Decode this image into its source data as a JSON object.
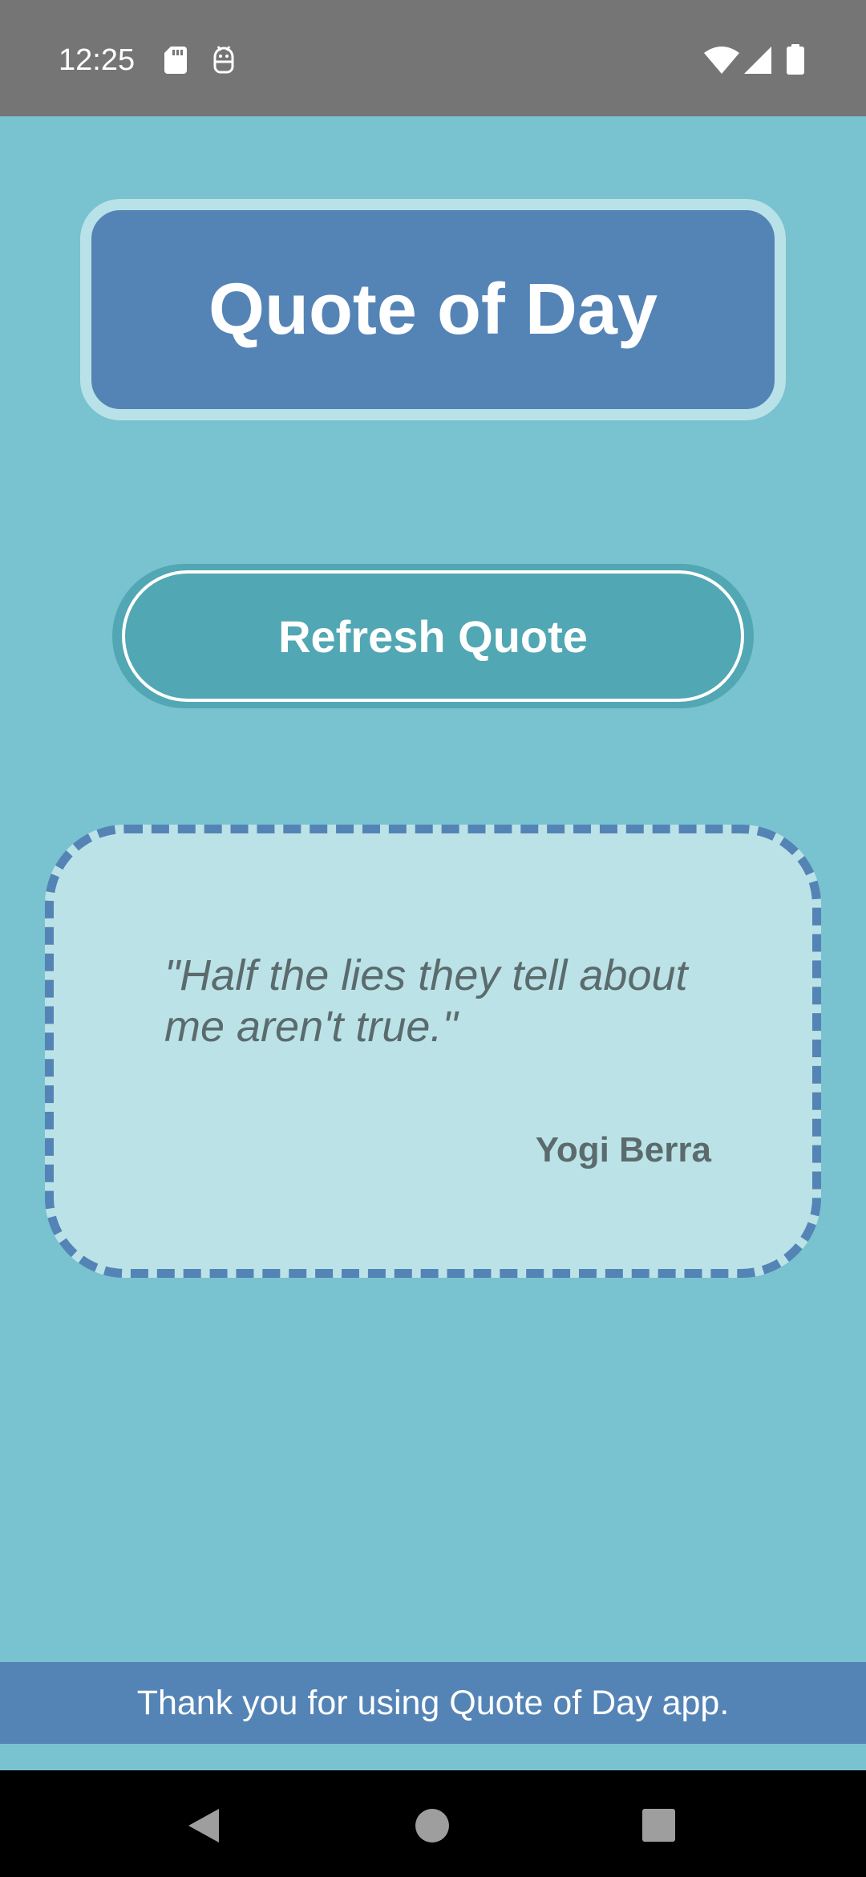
{
  "status_bar": {
    "time": "12:25",
    "icons": [
      "sd-card-icon",
      "android-debug-icon",
      "wifi-icon",
      "cellular-signal-icon",
      "battery-icon"
    ]
  },
  "header": {
    "title": "Quote of Day"
  },
  "actions": {
    "refresh_label": "Refresh Quote"
  },
  "quote": {
    "text": "\"Half the lies they tell about me aren't true.\"",
    "author": "Yogi Berra"
  },
  "footer": {
    "message": "Thank you for using Quote of Day app."
  },
  "nav_bar": {
    "buttons": [
      "back-icon",
      "home-icon",
      "recents-icon"
    ]
  },
  "colors": {
    "background": "#79c2cf",
    "title_card": "#5484b6",
    "title_border": "#b8e2e8",
    "button": "#51a7b3",
    "quote_card": "#bbe3e7",
    "quote_text": "#5b6b6d",
    "status_bar": "#757575",
    "nav_bar": "#000000"
  }
}
